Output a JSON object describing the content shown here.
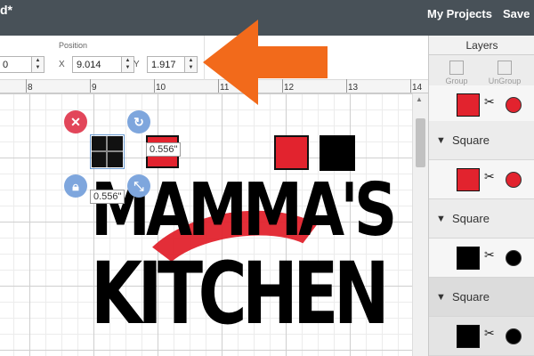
{
  "topbar": {
    "title": "d*",
    "my_projects": "My Projects",
    "save": "Save"
  },
  "toolbar": {
    "position_label": "Position",
    "w_value": "0",
    "x_label": "X",
    "x_value": "9.014",
    "y_label": "Y",
    "y_value": "1.917"
  },
  "ruler": {
    "ticks": [
      "8",
      "9",
      "10",
      "11",
      "12",
      "13",
      "14"
    ]
  },
  "canvas": {
    "width_dim": "0.556\"",
    "height_dim": "0.556\"",
    "text_line_1": "MAMMA'S",
    "text_line_2": "KITCHEN",
    "colors": {
      "red": "#e2232e",
      "black": "#000000",
      "arrow": "#f26a1b",
      "selection": "#6b9bd1",
      "delete": "#e2465a"
    }
  },
  "layers": {
    "title": "Layers",
    "group_label": "Group",
    "ungroup_label": "UnGroup",
    "items": [
      {
        "name": "",
        "color": "#e2232e"
      },
      {
        "name": "Square",
        "color": "#e2232e"
      },
      {
        "name": "Square",
        "color": "#000000"
      },
      {
        "name": "Square",
        "color": "#000000"
      }
    ]
  },
  "icons": {
    "delete": "close-icon",
    "rotate": "rotate-icon",
    "lock": "lock-icon",
    "scale": "scale-icon",
    "cut": "scissors-icon"
  }
}
